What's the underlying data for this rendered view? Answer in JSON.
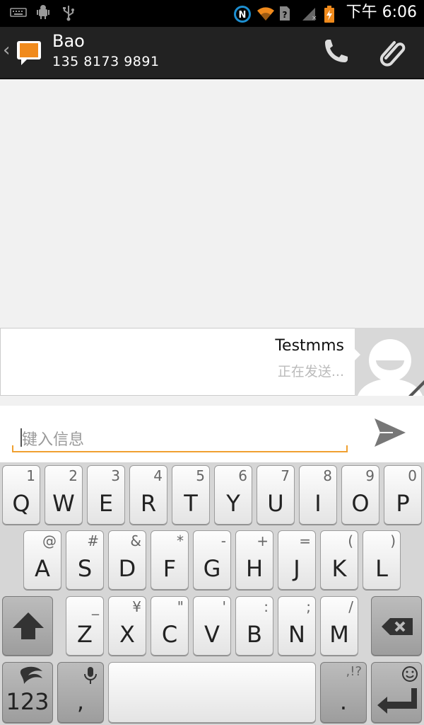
{
  "status_bar": {
    "time": "下午 6:06",
    "icons": [
      "keyboard-icon",
      "android-debug-icon",
      "usb-icon",
      "nfc-icon",
      "wifi-icon",
      "no-sim-icon",
      "signal-icon",
      "battery-charging-icon"
    ]
  },
  "action_bar": {
    "contact_name": "Bao",
    "contact_number": "135 8173 9891",
    "actions": [
      "phone-call-icon",
      "attach-icon"
    ]
  },
  "messages": [
    {
      "text": "Testmms",
      "status": "正在发送..."
    }
  ],
  "compose": {
    "placeholder": "键入信息"
  },
  "keyboard": {
    "row1": [
      {
        "main": "Q",
        "alt": "1"
      },
      {
        "main": "W",
        "alt": "2"
      },
      {
        "main": "E",
        "alt": "3"
      },
      {
        "main": "R",
        "alt": "4"
      },
      {
        "main": "T",
        "alt": "5"
      },
      {
        "main": "Y",
        "alt": "6"
      },
      {
        "main": "U",
        "alt": "7"
      },
      {
        "main": "I",
        "alt": "8"
      },
      {
        "main": "O",
        "alt": "9"
      },
      {
        "main": "P",
        "alt": "0"
      }
    ],
    "row2": [
      {
        "main": "A",
        "alt": "@"
      },
      {
        "main": "S",
        "alt": "#"
      },
      {
        "main": "D",
        "alt": "&"
      },
      {
        "main": "F",
        "alt": "*"
      },
      {
        "main": "G",
        "alt": "-"
      },
      {
        "main": "H",
        "alt": "+"
      },
      {
        "main": "J",
        "alt": "="
      },
      {
        "main": "K",
        "alt": "("
      },
      {
        "main": "L",
        "alt": ")"
      }
    ],
    "row3": [
      {
        "main": "Z",
        "alt": "_"
      },
      {
        "main": "X",
        "alt": "¥"
      },
      {
        "main": "C",
        "alt": "\""
      },
      {
        "main": "V",
        "alt": "'"
      },
      {
        "main": "B",
        "alt": ":"
      },
      {
        "main": "N",
        "alt": ";"
      },
      {
        "main": "M",
        "alt": "/"
      }
    ],
    "row4": {
      "numbers_label": "123",
      "comma_label": ",",
      "period_label": ".",
      "punct_alt": ",!?"
    }
  }
}
